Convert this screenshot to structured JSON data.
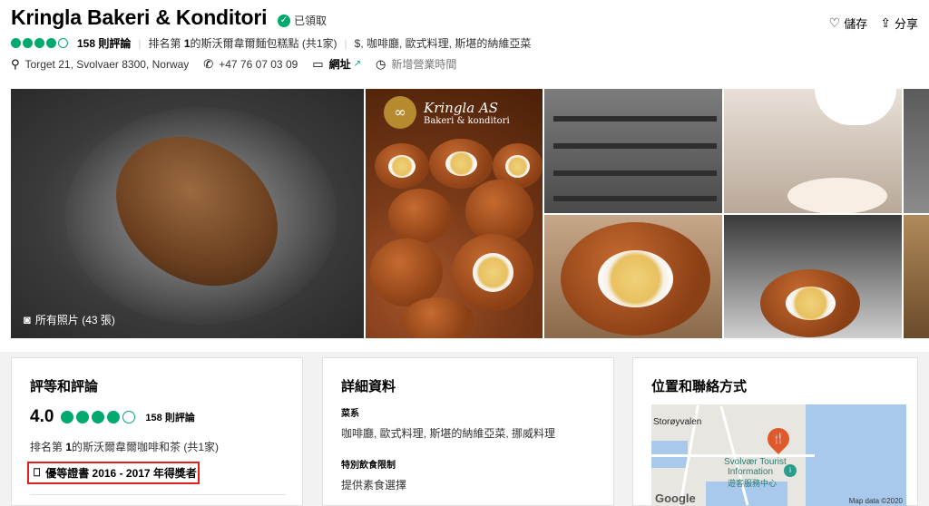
{
  "header": {
    "title": "Kringla Bakeri & Konditori",
    "claimed": "已領取",
    "rating_bubbles": 4,
    "review_count": "158 則評論",
    "rank_prefix": "排名第 ",
    "rank_number": "1",
    "rank_suffix": "的斯沃爾韋爾麵包糕點 (共1家)",
    "categories": "$, 咖啡廳, 歐式料理, 斯堪的納維亞菜",
    "address": "Torget 21, Svolvaer 8300, Norway",
    "phone": "+47 76 07 03 09",
    "website_label": "網址",
    "hours_label": "新增營業時間",
    "save_label": "儲存",
    "share_label": "分享"
  },
  "gallery": {
    "all_photos_label": "所有照片 (43 張)",
    "logo_line1": "Kringla AS",
    "logo_line2": "Bakeri & konditori"
  },
  "ratings_card": {
    "title": "評等和評論",
    "score": "4.0",
    "bubbles": 4,
    "review_count": "158 則評論",
    "rank_prefix": "排名第 ",
    "rank_number": "1",
    "rank_suffix": "的斯沃爾韋爾咖啡和茶 (共1家)",
    "award": "優等證書 2016 - 2017 年得獎者"
  },
  "details_card": {
    "title": "詳細資料",
    "cuisine_label": "菜系",
    "cuisine_value": "咖啡廳, 歐式料理, 斯堪的納維亞菜, 挪威料理",
    "diet_label": "特別飲食限制",
    "diet_value": "提供素食選擇"
  },
  "location_card": {
    "title": "位置和聯絡方式",
    "map_labels": {
      "area": "Storøyvalen",
      "poi_en_1": "Svolvær Tourist",
      "poi_en_2": "Information",
      "poi_zh": "遊客服務中心",
      "google": "Google",
      "map_data": "Map data ©2020"
    }
  },
  "colors": {
    "brand_green": "#00aa6c",
    "award_border": "#e02020",
    "map_pin": "#e0592a"
  }
}
